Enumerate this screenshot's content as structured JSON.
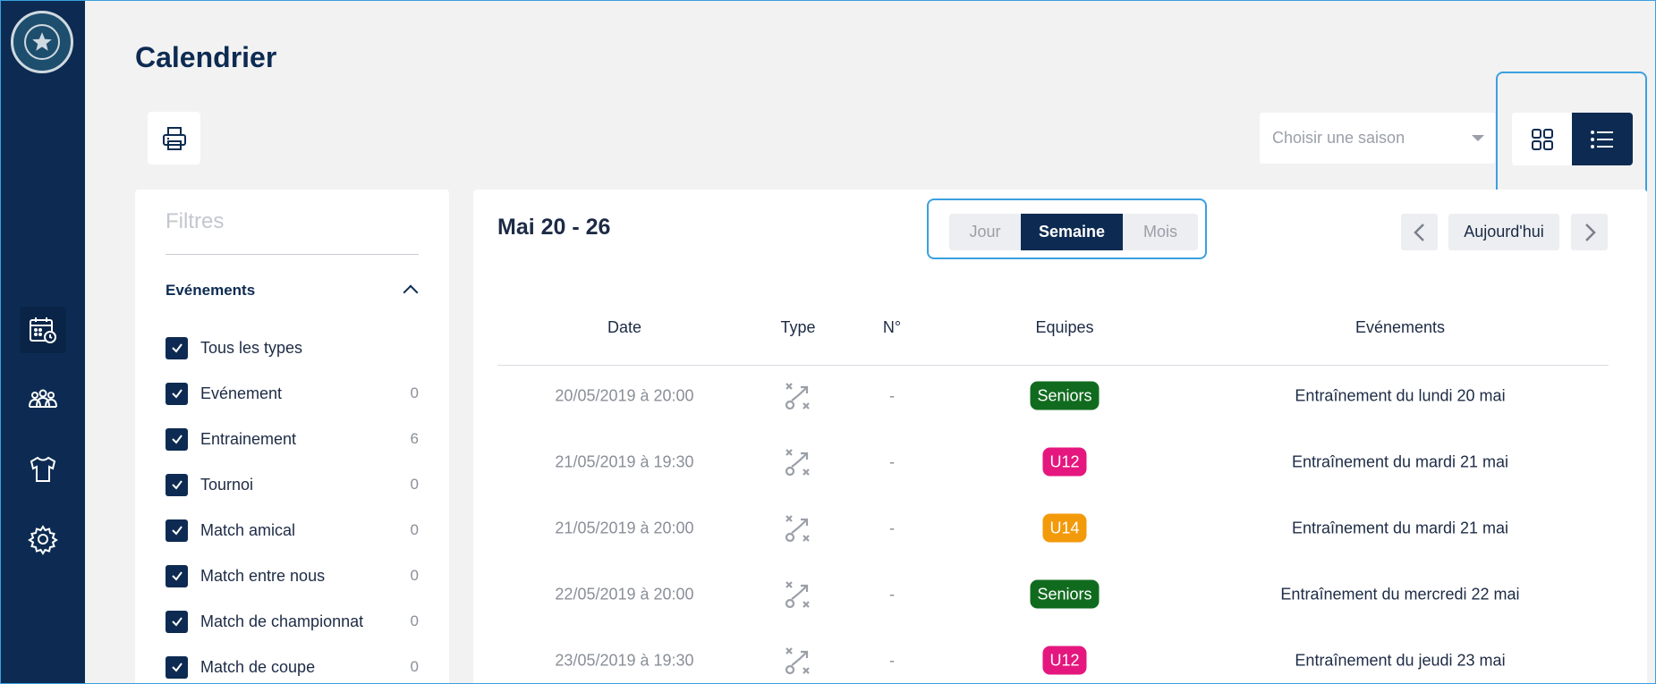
{
  "page": {
    "title": "Calendrier"
  },
  "season_select": {
    "placeholder": "Choisir une saison"
  },
  "filters": {
    "title": "Filtres",
    "section": "Evénements",
    "items": [
      {
        "label": "Tous les types",
        "count": ""
      },
      {
        "label": "Evénement",
        "count": "0"
      },
      {
        "label": "Entrainement",
        "count": "6"
      },
      {
        "label": "Tournoi",
        "count": "0"
      },
      {
        "label": "Match amical",
        "count": "0"
      },
      {
        "label": "Match entre nous",
        "count": "0"
      },
      {
        "label": "Match de championnat",
        "count": "0"
      },
      {
        "label": "Match de coupe",
        "count": "0"
      }
    ]
  },
  "calendar": {
    "range": "Mai 20 - 26",
    "modes": {
      "jour": "Jour",
      "semaine": "Semaine",
      "mois": "Mois"
    },
    "today": "Aujourd'hui"
  },
  "table": {
    "headers": {
      "date": "Date",
      "type": "Type",
      "num": "N°",
      "teams": "Equipes",
      "events": "Evénements"
    },
    "rows": [
      {
        "date": "20/05/2019 à 20:00",
        "num": "-",
        "team": "Seniors",
        "event": "Entraînement du lundi 20 mai"
      },
      {
        "date": "21/05/2019 à 19:30",
        "num": "-",
        "team": "U12",
        "event": "Entraînement du mardi 21 mai"
      },
      {
        "date": "21/05/2019 à 20:00",
        "num": "-",
        "team": "U14",
        "event": "Entraînement du mardi 21 mai"
      },
      {
        "date": "22/05/2019 à 20:00",
        "num": "-",
        "team": "Seniors",
        "event": "Entraînement du mercredi 22 mai"
      },
      {
        "date": "23/05/2019 à 19:30",
        "num": "-",
        "team": "U12",
        "event": "Entraînement du jeudi 23 mai"
      }
    ]
  },
  "colors": {
    "navy": "#0d2b52",
    "seniors": "#116b1f",
    "u12": "#e5177e",
    "u14": "#f39a0b",
    "highlight": "#3aa0e0"
  },
  "icons": {
    "sidebar": [
      "calendar-icon",
      "team-icon",
      "jersey-icon",
      "settings-icon"
    ],
    "toolbar": [
      "print-icon",
      "grid-view-icon",
      "list-view-icon"
    ],
    "type": "tactic-icon"
  }
}
